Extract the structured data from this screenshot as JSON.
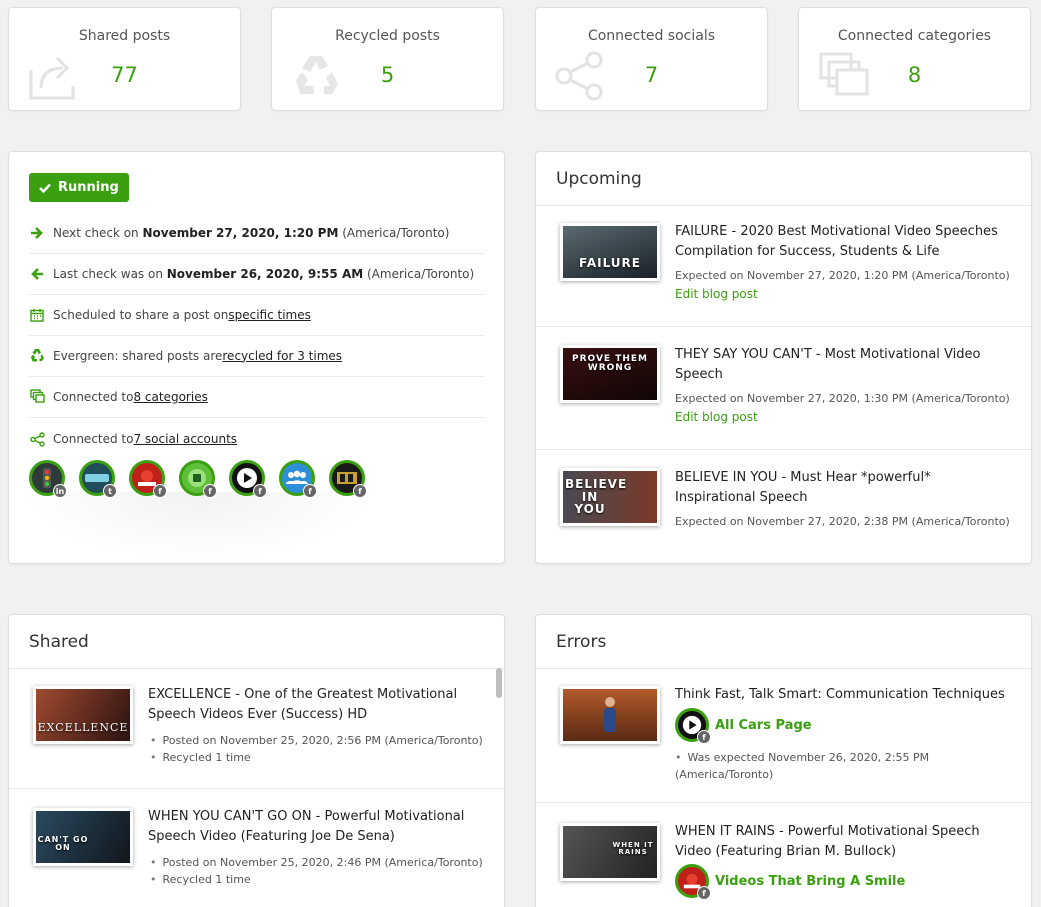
{
  "stats": [
    {
      "label": "Shared posts",
      "value": "77",
      "icon": "share-icon"
    },
    {
      "label": "Recycled posts",
      "value": "5",
      "icon": "recycle-icon"
    },
    {
      "label": "Connected socials",
      "value": "7",
      "icon": "share-nodes-icon"
    },
    {
      "label": "Connected categories",
      "value": "8",
      "icon": "categories-icon"
    }
  ],
  "status": {
    "badge": "Running",
    "next_check_prefix": "Next check on ",
    "next_check_date": "November 27, 2020, 1:20 PM",
    "next_check_tz": " (America/Toronto)",
    "last_check_prefix": "Last check was on ",
    "last_check_date": "November 26, 2020, 9:55 AM",
    "last_check_tz": " (America/Toronto)",
    "schedule_prefix": "Scheduled to share a post on ",
    "schedule_link": "specific times",
    "evergreen_prefix": "Evergreen: shared posts are ",
    "evergreen_link": "recycled for 3 times",
    "categories_prefix": "Connected to ",
    "categories_link": "8 categories",
    "socials_prefix": "Connected to ",
    "socials_link": "7 social accounts",
    "accounts": [
      {
        "network": "in",
        "bg": "#2f3a3a"
      },
      {
        "network": "t",
        "bg": "#1f4e5a"
      },
      {
        "network": "f",
        "bg": "#c0201a"
      },
      {
        "network": "f",
        "bg": "#5fbf3a"
      },
      {
        "network": "f",
        "bg": "#111111"
      },
      {
        "network": "f",
        "bg": "#2d8fd8"
      },
      {
        "network": "f",
        "bg": "#1a1a1a"
      }
    ]
  },
  "upcoming": {
    "title": "Upcoming",
    "items": [
      {
        "title": "FAILURE - 2020 Best Motivational Video Speeches Compilation for Success, Students & Life",
        "meta": "Expected on November 27, 2020, 1:20 PM (America/Toronto)",
        "link": "Edit blog post",
        "thumb_text": "FAILURE",
        "thumb_bg": "#2a3540"
      },
      {
        "title": "THEY SAY YOU CAN'T - Most Motivational Video Speech",
        "meta": "Expected on November 27, 2020, 1:30 PM (America/Toronto)",
        "link": "Edit blog post",
        "thumb_text": "PROVE THEM WRONG",
        "thumb_bg": "#3a1616"
      },
      {
        "title": "BELIEVE IN YOU - Must Hear *powerful* Inspirational Speech",
        "meta": "Expected on November 27, 2020, 2:38 PM (America/Toronto)",
        "thumb_text": "BELIEVE IN YOU",
        "thumb_bg": "#3c3431"
      }
    ]
  },
  "shared": {
    "title": "Shared",
    "items": [
      {
        "title": "EXCELLENCE - One of the Greatest Motivational Speech Videos Ever (Success) HD",
        "posted": "Posted on November 25, 2020, 2:56 PM (America/Toronto)",
        "recycled": "Recycled 1 time",
        "thumb_text": "EXCELLENCE",
        "thumb_bg": "#6a3326"
      },
      {
        "title": "WHEN YOU CAN'T GO ON - Powerful Motivational Speech Video (Featuring Joe De Sena)",
        "posted": "Posted on November 25, 2020, 2:46 PM (America/Toronto)",
        "recycled": "Recycled 1 time",
        "thumb_text": "CAN'T GO ON",
        "thumb_bg": "#223a4a"
      }
    ]
  },
  "errors": {
    "title": "Errors",
    "items": [
      {
        "title": "Think Fast, Talk Smart: Communication Techniques",
        "account": "All Cars Page",
        "meta": "Was expected November 26, 2020, 2:55 PM (America/Toronto)",
        "thumb_bg": "#8a3a1e",
        "avatar_bg": "#111111"
      },
      {
        "title": "WHEN IT RAINS - Powerful Motivational Speech Video (Featuring Brian M. Bullock)",
        "account": "Videos That Bring A Smile",
        "thumb_text": "WHEN IT RAINS",
        "thumb_bg": "#3a3a3a",
        "avatar_bg": "#c0201a"
      }
    ]
  },
  "colors": {
    "accent": "#3aa00f"
  }
}
